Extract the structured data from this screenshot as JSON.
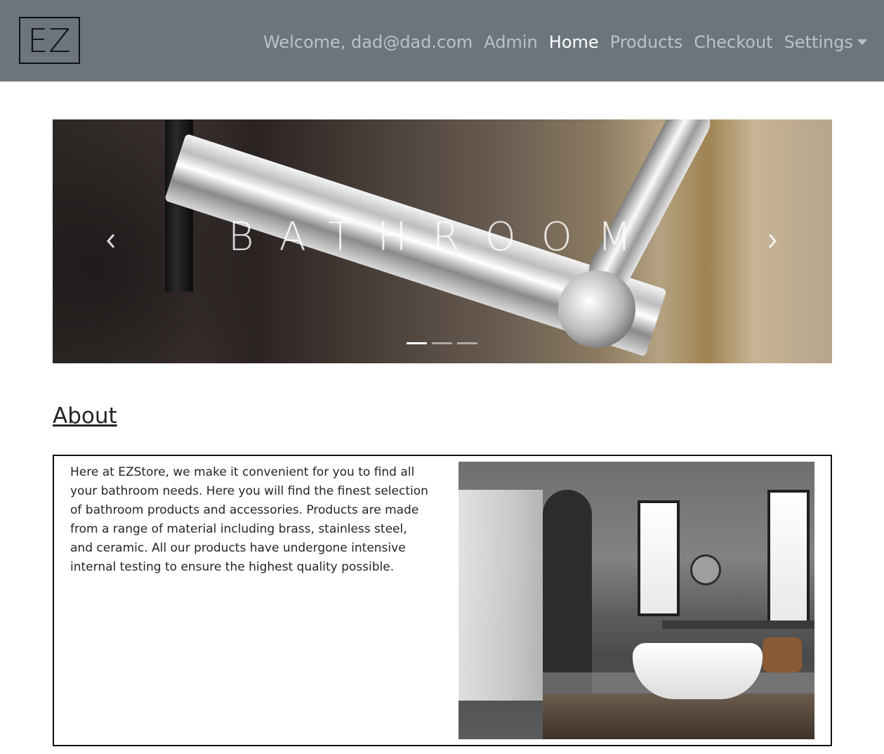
{
  "navbar": {
    "logo_text": "EZ",
    "welcome": "Welcome, dad@dad.com",
    "links": {
      "admin": "Admin",
      "home": "Home",
      "products": "Products",
      "checkout": "Checkout",
      "settings": "Settings"
    },
    "active": "Home",
    "colors": {
      "background": "#6c757d",
      "active_text": "#ffffff"
    }
  },
  "carousel": {
    "caption": "BATHROOM",
    "indicators": {
      "count": 3,
      "active_index": 0
    },
    "icons": {
      "prev": "chevron-left-icon",
      "next": "chevron-right-icon"
    }
  },
  "about": {
    "title": "About",
    "text": "Here at EZStore, we make it convenient for you to find all your bathroom needs. Here you will find the finest selection of bathroom products and accessories. Products are made from a range of material including brass, stainless steel, and ceramic. All our products have undergone intensive internal testing to ensure the highest quality possible."
  }
}
